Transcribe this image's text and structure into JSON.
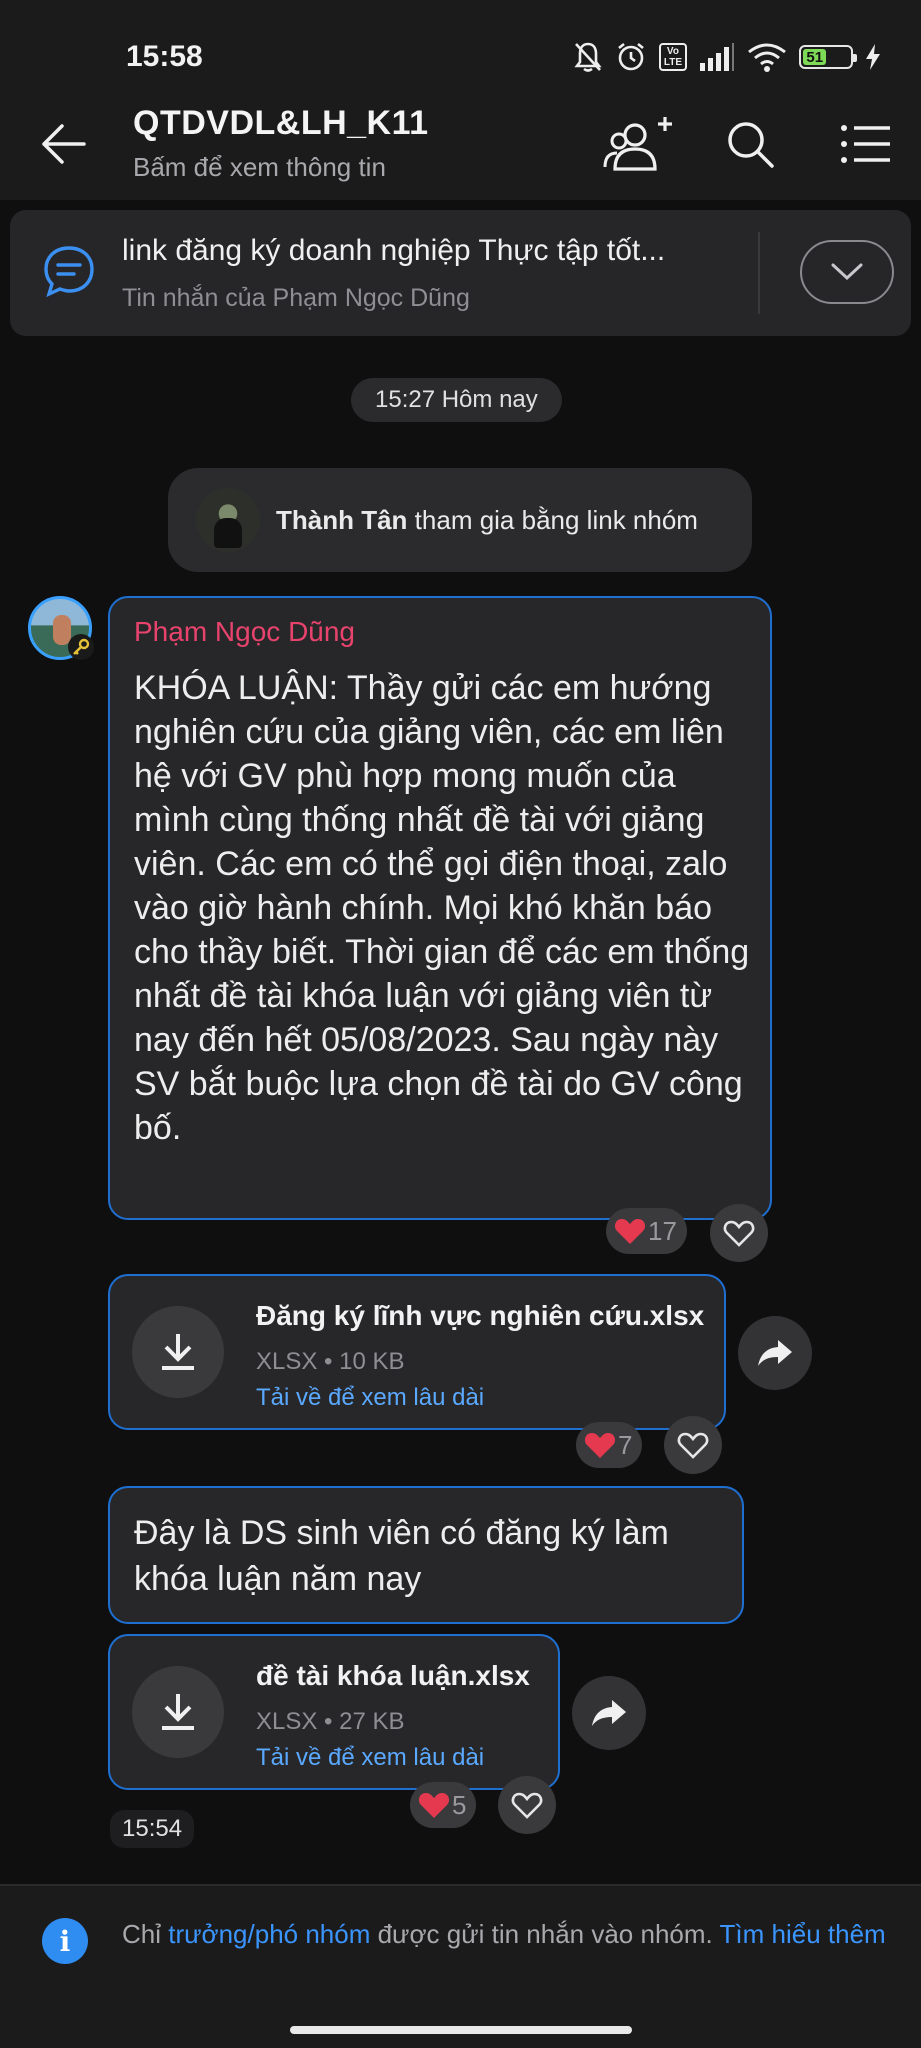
{
  "status_bar": {
    "time": "15:58",
    "battery_level": "51",
    "volte": "Vo\nLTE"
  },
  "header": {
    "title": "QTDVDL&LH_K11",
    "subtitle": "Bấm để xem thông tin"
  },
  "pinned": {
    "title": "link đăng ký doanh nghiệp Thực tập tốt...",
    "subtitle": "Tin nhắn của Phạm Ngọc Dũng"
  },
  "date_pill": "15:27 Hôm nay",
  "join_notice": {
    "name": "Thành Tân",
    "action": "tham gia bằng link nhóm"
  },
  "message1": {
    "sender": "Phạm Ngọc Dũng",
    "text": "KHÓA LUẬN: Thầy gửi các em hướng nghiên cứu của giảng viên, các em liên hệ với GV phù hợp mong muốn của mình cùng thống nhất đề tài với giảng viên. Các em có thể gọi điện thoại, zalo vào giờ hành chính. Mọi khó khăn báo cho thầy biết. Thời gian để các em thống nhất đề tài khóa luận với giảng viên từ nay đến hết 05/08/2023. Sau ngày này SV bắt buộc lựa chọn đề tài do GV công bố.",
    "reaction_count": "17"
  },
  "file1": {
    "name": "Đăng ký lĩnh vực nghiên cứu.xlsx",
    "meta": "XLSX • 10 KB",
    "link": "Tải về để xem lâu dài",
    "reaction_count": "7"
  },
  "message2": {
    "text": "Đây là DS sinh viên có đăng ký làm khóa luận năm nay"
  },
  "file2": {
    "name": "đề tài khóa luận.xlsx",
    "meta": "XLSX • 27 KB",
    "link": "Tải về để xem lâu dài",
    "reaction_count": "5"
  },
  "last_time": "15:54",
  "footer": {
    "prefix": "Chỉ ",
    "role_link": "trưởng/phó nhóm",
    "middle": " được gửi tin nhắn vào nhóm. ",
    "learn_more": "Tìm hiểu thêm"
  },
  "colors": {
    "accent": "#1f6fd1",
    "sender_name": "#e8436d",
    "link": "#5aa9ff",
    "heart": "#e53950"
  }
}
